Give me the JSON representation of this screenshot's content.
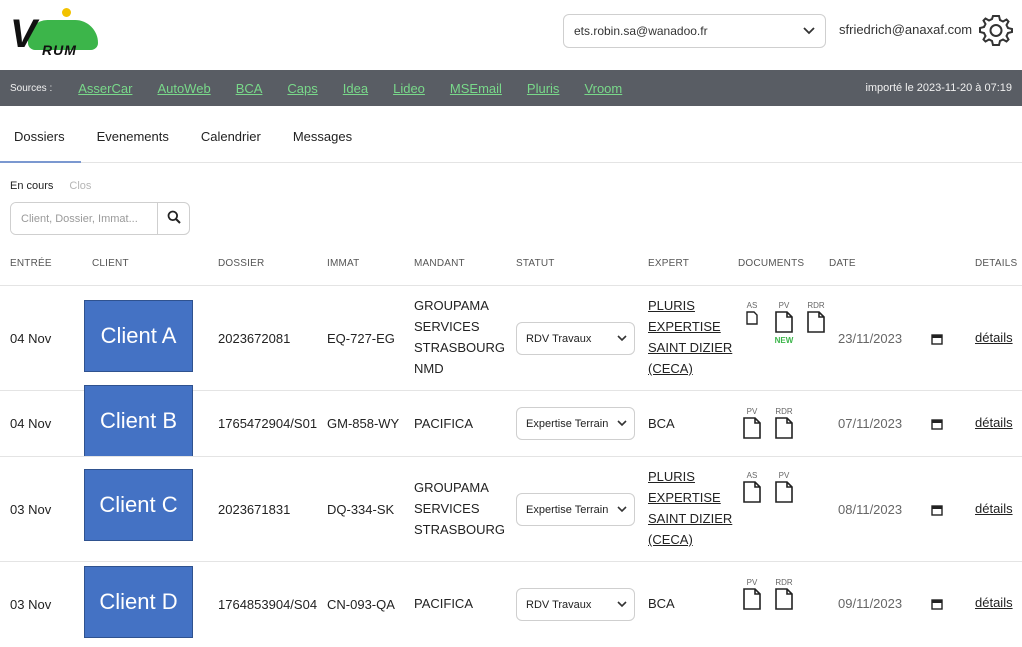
{
  "logo": {
    "letter": "V",
    "text": "RUM"
  },
  "account_select": {
    "value": "ets.robin.sa@wanadoo.fr"
  },
  "user_email": "sfriedrich@anaxaf.com",
  "colors": {
    "sources_bar": "#595d64",
    "source_link": "#79d98a",
    "client_box": "#4472c4",
    "logo_green": "#3cb54a",
    "tab_accent": "#7b98d0"
  },
  "sources": {
    "label": "Sources :",
    "links": [
      "AsserCar",
      "AutoWeb",
      "BCA",
      "Caps",
      "Idea",
      "Lideo",
      "MSEmail",
      "Pluris",
      "Vroom"
    ],
    "import_info": "importé le 2023-11-20 à 07:19"
  },
  "tabs": [
    "Dossiers",
    "Evenements",
    "Calendrier",
    "Messages"
  ],
  "subtabs": [
    "En cours",
    "Clos"
  ],
  "search": {
    "placeholder": "Client, Dossier, Immat...",
    "icon": "search-icon"
  },
  "table": {
    "headers": [
      "ENTRÉE",
      "CLIENT",
      "DOSSIER",
      "IMMAT",
      "MANDANT",
      "STATUT",
      "EXPERT",
      "DOCUMENTS",
      "DATE",
      "DETAILS"
    ],
    "rows": [
      {
        "entree": "04 Nov",
        "client": "Client A",
        "dossier": "2023672081",
        "immat": "EQ-727-EG",
        "mandant": [
          "GROUPAMA",
          "SERVICES",
          "STRASBOURG",
          "NMD"
        ],
        "statut": "RDV Travaux",
        "expert": [
          "PLURIS",
          "EXPERTISE",
          "SAINT DIZIER",
          "(CECA)"
        ],
        "expert_link": true,
        "documents": [
          {
            "label": "AS",
            "new": ""
          },
          {
            "label": "PV",
            "new": "NEW"
          },
          {
            "label": "RDR",
            "new": ""
          }
        ],
        "date": "23/11/2023",
        "details": "détails"
      },
      {
        "entree": "04 Nov",
        "client": "Client B",
        "dossier": "1765472904/S01",
        "immat": "GM-858-WY",
        "mandant": [
          "PACIFICA"
        ],
        "statut": "Expertise Terrain",
        "expert": [
          "BCA"
        ],
        "expert_link": false,
        "documents": [
          {
            "label": "PV",
            "new": ""
          },
          {
            "label": "RDR",
            "new": ""
          }
        ],
        "date": "07/11/2023",
        "details": "détails"
      },
      {
        "entree": "03 Nov",
        "client": "Client C",
        "dossier": "2023671831",
        "immat": "DQ-334-SK",
        "mandant": [
          "GROUPAMA",
          "SERVICES",
          "STRASBOURG"
        ],
        "statut": "Expertise Terrain",
        "expert": [
          "PLURIS",
          "EXPERTISE",
          "SAINT DIZIER",
          "(CECA)"
        ],
        "expert_link": true,
        "documents": [
          {
            "label": "AS",
            "new": ""
          },
          {
            "label": "PV",
            "new": ""
          }
        ],
        "date": "08/11/2023",
        "details": "détails"
      },
      {
        "entree": "03 Nov",
        "client": "Client D",
        "dossier": "1764853904/S04",
        "immat": "CN-093-QA",
        "mandant": [
          "PACIFICA"
        ],
        "statut": "RDV Travaux",
        "expert": [
          "BCA"
        ],
        "expert_link": false,
        "documents": [
          {
            "label": "PV",
            "new": ""
          },
          {
            "label": "RDR",
            "new": ""
          }
        ],
        "date": "09/11/2023",
        "details": "détails"
      }
    ]
  }
}
